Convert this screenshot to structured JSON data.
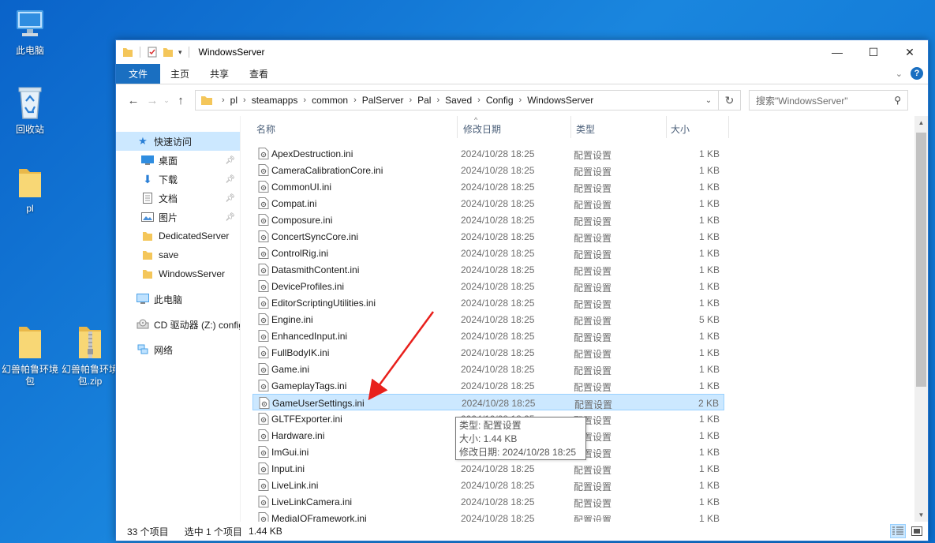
{
  "desktop": {
    "icons": [
      {
        "label": "此电脑"
      },
      {
        "label": "回收站"
      },
      {
        "label": "pl"
      },
      {
        "label": "幻兽帕鲁环境包"
      },
      {
        "label": "幻兽帕鲁环境包.zip"
      }
    ]
  },
  "window": {
    "title": "WindowsServer",
    "controls": {
      "minimize": "—",
      "maximize": "☐",
      "close": "✕"
    }
  },
  "ribbon": {
    "tabs": [
      "文件",
      "主页",
      "共享",
      "查看"
    ],
    "help": "?"
  },
  "nav": {
    "path": [
      "pl",
      "steamapps",
      "common",
      "PalServer",
      "Pal",
      "Saved",
      "Config",
      "WindowsServer"
    ],
    "search_placeholder": "搜索\"WindowsServer\""
  },
  "sidebar": {
    "quick_access": "快速访问",
    "items": [
      {
        "label": "桌面",
        "pinned": true
      },
      {
        "label": "下载",
        "pinned": true
      },
      {
        "label": "文档",
        "pinned": true
      },
      {
        "label": "图片",
        "pinned": true
      },
      {
        "label": "DedicatedServer",
        "pinned": false
      },
      {
        "label": "save",
        "pinned": false
      },
      {
        "label": "WindowsServer",
        "pinned": false
      }
    ],
    "this_pc": "此电脑",
    "cd_drive": "CD 驱动器 (Z:) config",
    "network": "网络"
  },
  "columns": {
    "name": "名称",
    "date": "修改日期",
    "type": "类型",
    "size": "大小"
  },
  "files": [
    {
      "name": "ApexDestruction.ini",
      "date": "2024/10/28 18:25",
      "type": "配置设置",
      "size": "1 KB"
    },
    {
      "name": "CameraCalibrationCore.ini",
      "date": "2024/10/28 18:25",
      "type": "配置设置",
      "size": "1 KB"
    },
    {
      "name": "CommonUI.ini",
      "date": "2024/10/28 18:25",
      "type": "配置设置",
      "size": "1 KB"
    },
    {
      "name": "Compat.ini",
      "date": "2024/10/28 18:25",
      "type": "配置设置",
      "size": "1 KB"
    },
    {
      "name": "Composure.ini",
      "date": "2024/10/28 18:25",
      "type": "配置设置",
      "size": "1 KB"
    },
    {
      "name": "ConcertSyncCore.ini",
      "date": "2024/10/28 18:25",
      "type": "配置设置",
      "size": "1 KB"
    },
    {
      "name": "ControlRig.ini",
      "date": "2024/10/28 18:25",
      "type": "配置设置",
      "size": "1 KB"
    },
    {
      "name": "DatasmithContent.ini",
      "date": "2024/10/28 18:25",
      "type": "配置设置",
      "size": "1 KB"
    },
    {
      "name": "DeviceProfiles.ini",
      "date": "2024/10/28 18:25",
      "type": "配置设置",
      "size": "1 KB"
    },
    {
      "name": "EditorScriptingUtilities.ini",
      "date": "2024/10/28 18:25",
      "type": "配置设置",
      "size": "1 KB"
    },
    {
      "name": "Engine.ini",
      "date": "2024/10/28 18:25",
      "type": "配置设置",
      "size": "5 KB"
    },
    {
      "name": "EnhancedInput.ini",
      "date": "2024/10/28 18:25",
      "type": "配置设置",
      "size": "1 KB"
    },
    {
      "name": "FullBodyIK.ini",
      "date": "2024/10/28 18:25",
      "type": "配置设置",
      "size": "1 KB"
    },
    {
      "name": "Game.ini",
      "date": "2024/10/28 18:25",
      "type": "配置设置",
      "size": "1 KB"
    },
    {
      "name": "GameplayTags.ini",
      "date": "2024/10/28 18:25",
      "type": "配置设置",
      "size": "1 KB"
    },
    {
      "name": "GameUserSettings.ini",
      "date": "2024/10/28 18:25",
      "type": "配置设置",
      "size": "2 KB",
      "selected": true
    },
    {
      "name": "GLTFExporter.ini",
      "date": "2024/10/28 18:25",
      "type": "配置设置",
      "size": "1 KB"
    },
    {
      "name": "Hardware.ini",
      "date": "2024/10/28 18:25",
      "type": "配置设置",
      "size": "1 KB"
    },
    {
      "name": "ImGui.ini",
      "date": "2024/10/28 18:25",
      "type": "配置设置",
      "size": "1 KB"
    },
    {
      "name": "Input.ini",
      "date": "2024/10/28 18:25",
      "type": "配置设置",
      "size": "1 KB"
    },
    {
      "name": "LiveLink.ini",
      "date": "2024/10/28 18:25",
      "type": "配置设置",
      "size": "1 KB"
    },
    {
      "name": "LiveLinkCamera.ini",
      "date": "2024/10/28 18:25",
      "type": "配置设置",
      "size": "1 KB"
    },
    {
      "name": "MediaIOFramework.ini",
      "date": "2024/10/28 18:25",
      "type": "配置设置",
      "size": "1 KB"
    }
  ],
  "tooltip": {
    "type_line": "类型: 配置设置",
    "size_line": "大小: 1.44 KB",
    "date_line": "修改日期: 2024/10/28 18:25"
  },
  "status": {
    "count": "33 个项目",
    "selected": "选中 1 个项目",
    "size": "1.44 KB"
  },
  "colors": {
    "accent": "#1a6fc1",
    "selection": "#cce8ff",
    "annotation_arrow": "#e8201c"
  }
}
